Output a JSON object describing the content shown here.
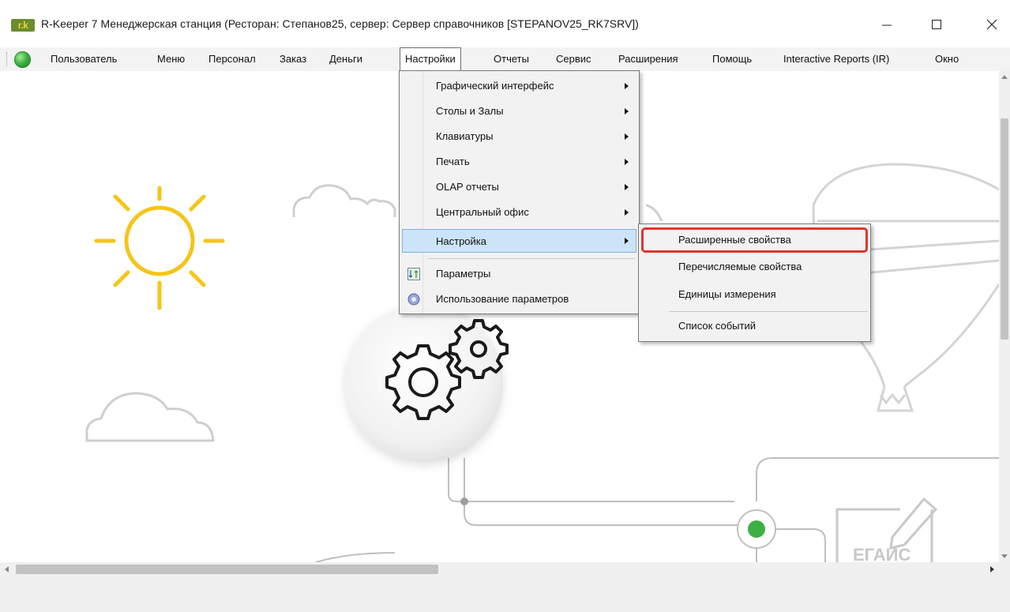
{
  "window": {
    "logo_text": "r.k",
    "title": "R-Keeper 7 Менеджерская станция (Ресторан: Степанов25, сервер: Сервер справочников [STEPANOV25_RK7SRV])"
  },
  "menubar": {
    "items": [
      {
        "label": "Пользователь"
      },
      {
        "label": "Меню"
      },
      {
        "label": "Персонал"
      },
      {
        "label": "Заказ"
      },
      {
        "label": "Деньги"
      },
      {
        "label": "Настройки"
      },
      {
        "label": "Отчеты"
      },
      {
        "label": "Сервис"
      },
      {
        "label": "Расширения"
      },
      {
        "label": "Помощь"
      },
      {
        "label": "Interactive Reports (IR)"
      },
      {
        "label": "Окно"
      }
    ],
    "active_index": 5
  },
  "dropdown": {
    "items": [
      {
        "label": "Графический интерфейс",
        "submenu": true
      },
      {
        "label": "Столы и Залы",
        "submenu": true
      },
      {
        "label": "Клавиатуры",
        "submenu": true
      },
      {
        "label": "Печать",
        "submenu": true
      },
      {
        "label": "OLAP отчеты",
        "submenu": true
      },
      {
        "label": "Центральный офис",
        "submenu": true
      },
      {
        "label": "Настройка",
        "submenu": true,
        "highlighted": true
      },
      {
        "label": "Параметры",
        "icon": "sort-parameters-icon"
      },
      {
        "label": "Использование параметров",
        "icon": "gear-circle-icon"
      }
    ]
  },
  "submenu": {
    "items": [
      {
        "label": "Расширенные свойства",
        "highlighted_box": true
      },
      {
        "label": "Перечисляемые свойства"
      },
      {
        "label": "Единицы измерения"
      },
      {
        "label": "Список событий"
      }
    ]
  },
  "canvas": {
    "egais_label": "ЕГАИС"
  },
  "colors": {
    "accent_highlight": "#cce4f7",
    "callout_red": "#e0352b",
    "sun_yellow": "#f5c518",
    "status_green": "#3cb043"
  }
}
